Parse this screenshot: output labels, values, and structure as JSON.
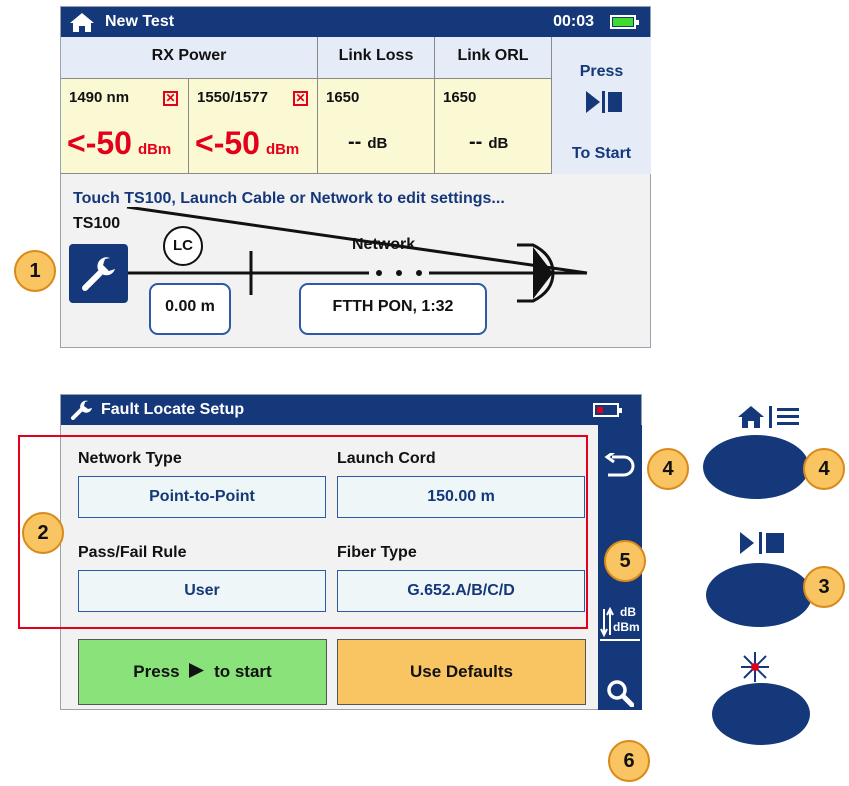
{
  "test_screen": {
    "title": "New Test",
    "time": "00:03",
    "headers": {
      "rx_power": "RX Power",
      "link_loss": "Link Loss",
      "link_orl": "Link ORL"
    },
    "cells": [
      {
        "wavelength": "1490 nm",
        "value": "<-50",
        "unit": "dBm"
      },
      {
        "wavelength": "1550/1577",
        "value": "<-50",
        "unit": "dBm"
      },
      {
        "wavelength": "1650",
        "value": "--",
        "unit": "dB"
      },
      {
        "wavelength": "1650",
        "value": "--",
        "unit": "dB"
      }
    ],
    "press_top": "Press",
    "press_bottom": "To Start",
    "hint": "Touch TS100, Launch Cable or Network to edit settings...",
    "device_label": "TS100",
    "connector_label": "LC",
    "network_label": "Network",
    "launch_length": "0.00 m",
    "network_value": "FTTH PON, 1:32"
  },
  "setup_screen": {
    "title": "Fault Locate Setup",
    "fields": [
      {
        "label": "Network Type",
        "value": "Point-to-Point"
      },
      {
        "label": "Launch Cord",
        "value": "150.00 m"
      },
      {
        "label": "Pass/Fail Rule",
        "value": "User"
      },
      {
        "label": "Fiber Type",
        "value": "G.652.A/B/C/D"
      }
    ],
    "start_prefix": "Press",
    "start_suffix": "to start",
    "defaults_label": "Use Defaults",
    "unit_toggle_top": "dB",
    "unit_toggle_bottom": "dBm"
  },
  "callouts": [
    "1",
    "2",
    "3",
    "4",
    "4",
    "5",
    "6"
  ],
  "colors": {
    "navy": "#15387a",
    "meter_bg": "#fbf8d4",
    "alarm_red": "#e3001b",
    "start_green": "#8ae37a",
    "defaults_orange": "#f9c462",
    "callout_orange": "#f9c462",
    "highlight_box": "#e3001b"
  },
  "icons": [
    "home-icon",
    "battery-icon",
    "x-box-icon",
    "play-stop-icon",
    "wrench-icon",
    "back-arrow-icon",
    "unit-toggle-icon",
    "search-icon",
    "menu-icon",
    "laser-icon"
  ]
}
